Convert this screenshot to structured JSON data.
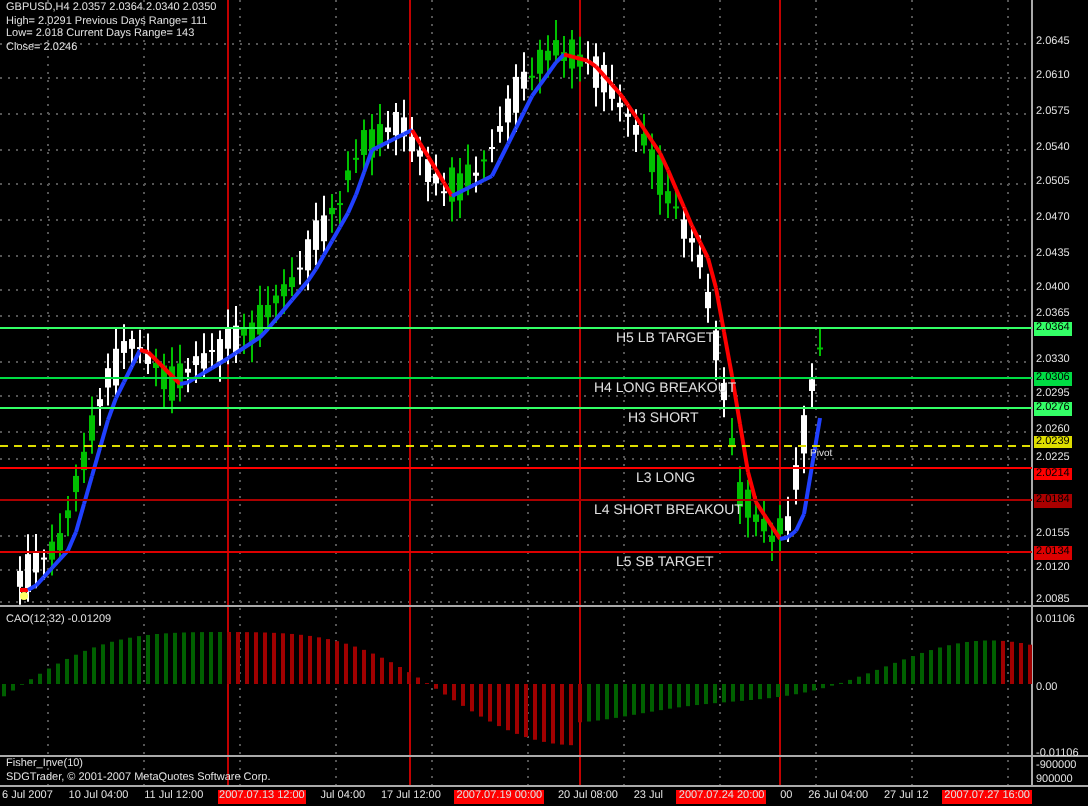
{
  "info_lines": [
    "GBPUSD,H4  2.0357 2.0364 2.0340 2.0350",
    "High= 2.0291   Previous Days Range= 111",
    "Low= 2.018   Current Days Range= 143",
    "Close= 2.0246"
  ],
  "price_axis": [
    "2.0645",
    "2.0610",
    "2.0575",
    "2.0540",
    "2.0505",
    "2.0470",
    "2.0435",
    "2.0400",
    "2.0365",
    "2.0330",
    "2.0295",
    "2.0260",
    "2.0225",
    "2.0155",
    "2.0120",
    "2.0085"
  ],
  "levels": [
    {
      "label": "H5 LB TARGET",
      "price": "2.0364",
      "kind": "solid",
      "color": "#33ff66"
    },
    {
      "label": "H4 LONG BREAKOUT",
      "price": "2.0306",
      "kind": "solid",
      "color": "#00dd44"
    },
    {
      "label": "H3 SHORT",
      "price": "2.0276",
      "kind": "solid",
      "color": "#33ff66"
    },
    {
      "label": "Pivot",
      "price": "2.0239",
      "kind": "dashed",
      "color": "#dddd00"
    },
    {
      "label": "L3 LONG",
      "price": "2.0214",
      "kind": "solid",
      "color": "#ff0000"
    },
    {
      "label": "L4 SHORT BREAKOUT",
      "price": "2.0184",
      "kind": "solid",
      "color": "#aa0000"
    },
    {
      "label": "L5 SB TARGET",
      "price": "2.0134",
      "kind": "solid",
      "color": "#dd0000"
    }
  ],
  "indicator": {
    "name": "CAO(12,32) -0.01209",
    "axis": [
      "0.01106",
      "0.00",
      "-0.01106"
    ]
  },
  "fisher": {
    "name": "Fisher_Inve(10)",
    "credit": "SDGTrader, © 2001-2007 MetaQuotes Software Corp.",
    "axis": [
      "-900000",
      "900000"
    ]
  },
  "time_axis": [
    {
      "text": "6 Jul 2007",
      "kind": "date"
    },
    {
      "text": "10 Jul 04:00",
      "kind": "date"
    },
    {
      "text": "11 Jul 12:00",
      "kind": "date"
    },
    {
      "text": "2007.07.13 12:00",
      "kind": "marker"
    },
    {
      "text": "Jul 04:00",
      "kind": "date"
    },
    {
      "text": "17 Jul 12:00",
      "kind": "date"
    },
    {
      "text": "2007.07.19 00:00",
      "kind": "marker"
    },
    {
      "text": "20 Jul 08:00",
      "kind": "date"
    },
    {
      "text": "23 Jul",
      "kind": "date"
    },
    {
      "text": "2007.07.24 20:00",
      "kind": "marker"
    },
    {
      "text": "00",
      "kind": "date"
    },
    {
      "text": "26 Jul 04:00",
      "kind": "date"
    },
    {
      "text": "27 Jul 12",
      "kind": "date"
    },
    {
      "text": "2007.07.27 16:00",
      "kind": "marker"
    }
  ]
}
